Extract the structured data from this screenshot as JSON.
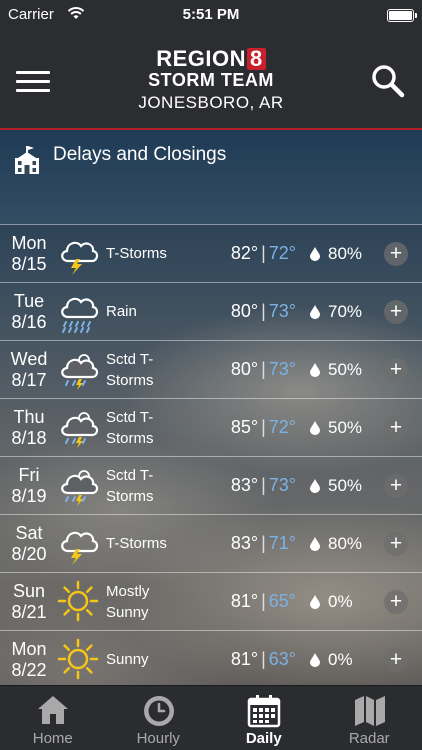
{
  "status_bar": {
    "carrier": "Carrier",
    "time": "5:51 PM"
  },
  "header": {
    "logo_region": "REGION",
    "logo_number": "8",
    "logo_team": "STORM TEAM",
    "location": "JONESBORO, AR"
  },
  "delays": {
    "label": "Delays and Closings"
  },
  "forecast": [
    {
      "dow": "Mon",
      "date": "8/15",
      "icon": "thunderstorm-icon",
      "cond1": "T-Storms",
      "cond2": "",
      "high": "82°",
      "low": "72°",
      "precip": "80%"
    },
    {
      "dow": "Tue",
      "date": "8/16",
      "icon": "rain-icon",
      "cond1": "Rain",
      "cond2": "",
      "high": "80°",
      "low": "73°",
      "precip": "70%"
    },
    {
      "dow": "Wed",
      "date": "8/17",
      "icon": "scattered-storms-icon",
      "cond1": "Sctd T-",
      "cond2": "Storms",
      "high": "80°",
      "low": "73°",
      "precip": "50%"
    },
    {
      "dow": "Thu",
      "date": "8/18",
      "icon": "scattered-storms-icon",
      "cond1": "Sctd T-",
      "cond2": "Storms",
      "high": "85°",
      "low": "72°",
      "precip": "50%"
    },
    {
      "dow": "Fri",
      "date": "8/19",
      "icon": "scattered-storms-icon",
      "cond1": "Sctd T-",
      "cond2": "Storms",
      "high": "83°",
      "low": "73°",
      "precip": "50%"
    },
    {
      "dow": "Sat",
      "date": "8/20",
      "icon": "thunderstorm-icon",
      "cond1": "T-Storms",
      "cond2": "",
      "high": "83°",
      "low": "71°",
      "precip": "80%"
    },
    {
      "dow": "Sun",
      "date": "8/21",
      "icon": "sun-icon",
      "cond1": "Mostly",
      "cond2": "Sunny",
      "high": "81°",
      "low": "65°",
      "precip": "0%"
    },
    {
      "dow": "Mon",
      "date": "8/22",
      "icon": "sun-icon",
      "cond1": "Sunny",
      "cond2": "",
      "high": "81°",
      "low": "63°",
      "precip": "0%"
    }
  ],
  "tabs": [
    {
      "label": "Home",
      "icon": "home-icon"
    },
    {
      "label": "Hourly",
      "icon": "clock-icon"
    },
    {
      "label": "Daily",
      "icon": "calendar-icon"
    },
    {
      "label": "Radar",
      "icon": "map-icon"
    }
  ],
  "active_tab": "Daily",
  "colors": {
    "accent_red": "#c8202c",
    "low_temp": "#7db1e3",
    "bolt": "#f5c518",
    "sun": "#f5c518",
    "rain": "#7db1e3"
  }
}
